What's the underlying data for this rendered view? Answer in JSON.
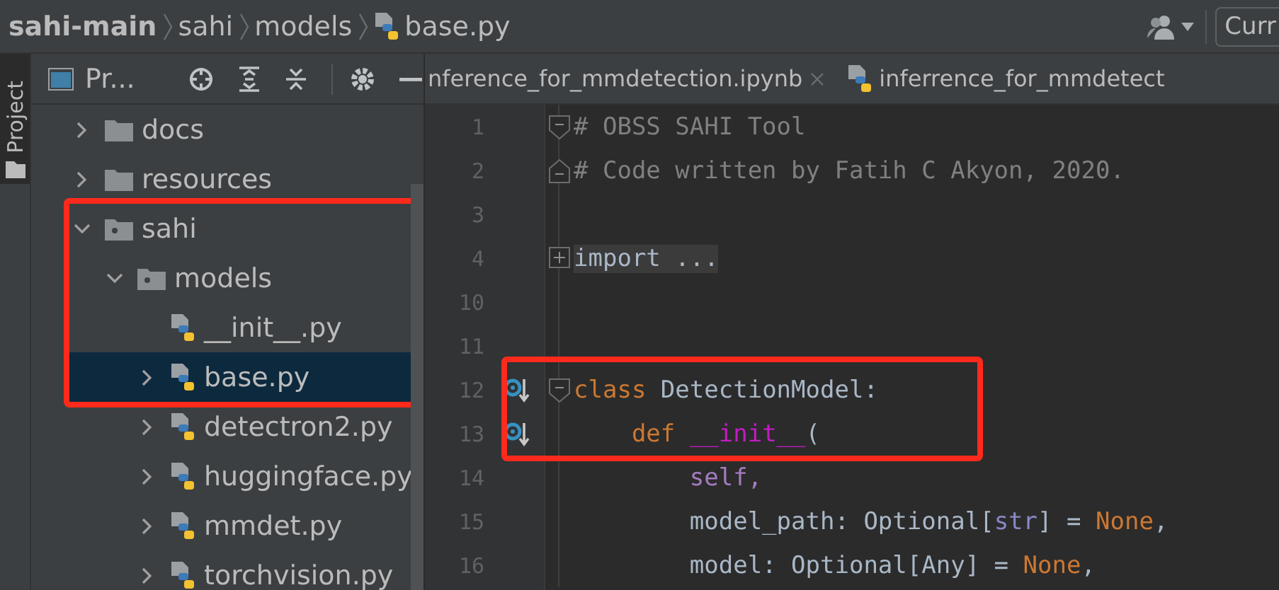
{
  "breadcrumbs": [
    {
      "label": "sahi-main",
      "kind": "root"
    },
    {
      "label": "sahi",
      "kind": "folder"
    },
    {
      "label": "models",
      "kind": "folder"
    },
    {
      "label": "base.py",
      "kind": "python"
    }
  ],
  "header_right": {
    "vcs_button": "Curr"
  },
  "side_tab": {
    "label": "Project",
    "selected": true
  },
  "project_toolbar": {
    "title": "Pr..."
  },
  "tabs": [
    {
      "label": "nference_for_mmdetection.ipynb",
      "kind": "plain",
      "selected": false,
      "closable": true
    },
    {
      "label": "inferrence_for_mmdetect",
      "kind": "python",
      "selected": false,
      "closable": false
    }
  ],
  "tree": [
    {
      "label": "docs",
      "kind": "folder",
      "expanded": false,
      "selected": false,
      "boxed": false
    },
    {
      "label": "resources",
      "kind": "folder",
      "expanded": false,
      "selected": false,
      "boxed": false
    },
    {
      "label": "sahi",
      "kind": "package",
      "expanded": true,
      "selected": false,
      "boxed": true,
      "children": [
        {
          "label": "models",
          "kind": "package",
          "expanded": true,
          "selected": false,
          "boxed": true,
          "children": [
            {
              "label": "__init__.py",
              "kind": "python",
              "selected": false,
              "boxed": true
            },
            {
              "label": "base.py",
              "kind": "python",
              "expanded": false,
              "selected": true,
              "boxed": true
            },
            {
              "label": "detectron2.py",
              "kind": "python",
              "expanded": false,
              "selected": false,
              "boxed": false
            },
            {
              "label": "huggingface.py",
              "kind": "python",
              "expanded": false,
              "selected": false,
              "boxed": false
            },
            {
              "label": "mmdet.py",
              "kind": "python",
              "expanded": false,
              "selected": false,
              "boxed": false
            },
            {
              "label": "torchvision.py",
              "kind": "python",
              "expanded": false,
              "selected": false,
              "boxed": false
            }
          ]
        }
      ]
    }
  ],
  "code": [
    {
      "number": "1",
      "fold_start": true,
      "tokens": [
        {
          "kind": "comment",
          "text": "# OBSS SAHI Tool"
        }
      ]
    },
    {
      "number": "2",
      "fold_end": true,
      "tokens": [
        {
          "kind": "comment",
          "text": "# Code written by Fatih C Akyon, 2020."
        }
      ]
    },
    {
      "number": "3"
    },
    {
      "number": "4",
      "folded": true,
      "tokens": [
        {
          "kind": "folded",
          "text": "import ..."
        }
      ]
    },
    {
      "number": "10"
    },
    {
      "number": "11"
    },
    {
      "number": "12",
      "fold_start": true,
      "override": true,
      "boxed": true,
      "tokens": [
        {
          "kind": "keyword",
          "text": "class"
        },
        {
          "kind": "plain",
          "text": " DetectionModel:"
        }
      ]
    },
    {
      "number": "13",
      "override": true,
      "boxed": true,
      "tokens": [
        {
          "kind": "keyword",
          "text": "    def"
        },
        {
          "kind": "magic",
          "text": " __init__"
        },
        {
          "kind": "plain",
          "text": "("
        }
      ]
    },
    {
      "number": "14",
      "tokens": [
        {
          "kind": "self",
          "text": "        self,"
        }
      ]
    },
    {
      "number": "15",
      "tokens": [
        {
          "kind": "plain",
          "text": "        model_path: Optional["
        },
        {
          "kind": "builtin",
          "text": "str"
        },
        {
          "kind": "plain",
          "text": "] = "
        },
        {
          "kind": "keyword",
          "text": "None"
        },
        {
          "kind": "plain",
          "text": ","
        }
      ]
    },
    {
      "number": "16",
      "tokens": [
        {
          "kind": "plain",
          "text": "        model: Optional[Any] = "
        },
        {
          "kind": "keyword",
          "text": "None"
        },
        {
          "kind": "plain",
          "text": ","
        }
      ]
    }
  ]
}
